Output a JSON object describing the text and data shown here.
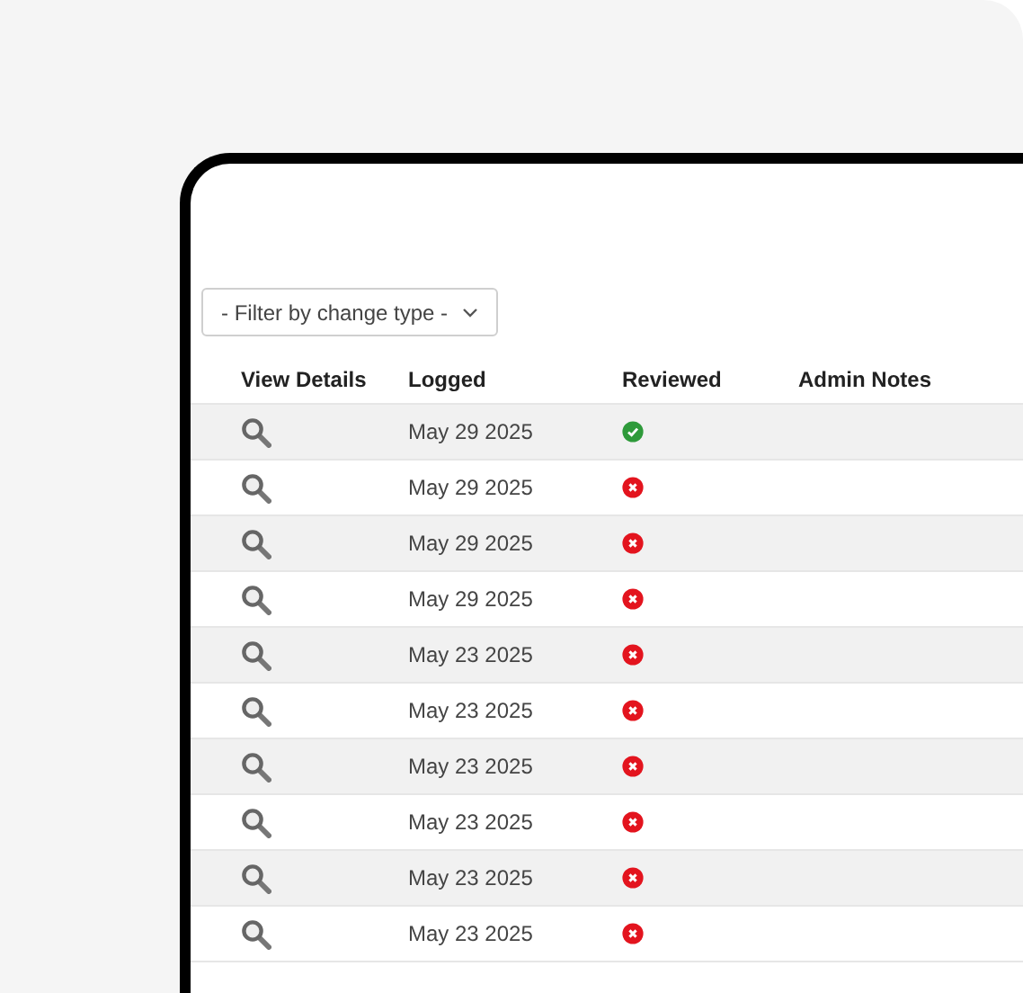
{
  "filter": {
    "label": "- Filter by change type -"
  },
  "table": {
    "columns": [
      "View Details",
      "Logged",
      "Reviewed",
      "Admin Notes"
    ],
    "rows": [
      {
        "logged": "May 29 2025",
        "reviewed": true
      },
      {
        "logged": "May 29 2025",
        "reviewed": false
      },
      {
        "logged": "May 29 2025",
        "reviewed": false
      },
      {
        "logged": "May 29 2025",
        "reviewed": false
      },
      {
        "logged": "May 23 2025",
        "reviewed": false
      },
      {
        "logged": "May 23 2025",
        "reviewed": false
      },
      {
        "logged": "May 23 2025",
        "reviewed": false
      },
      {
        "logged": "May 23 2025",
        "reviewed": false
      },
      {
        "logged": "May 23 2025",
        "reviewed": false
      },
      {
        "logged": "May 23 2025",
        "reviewed": false
      }
    ]
  }
}
